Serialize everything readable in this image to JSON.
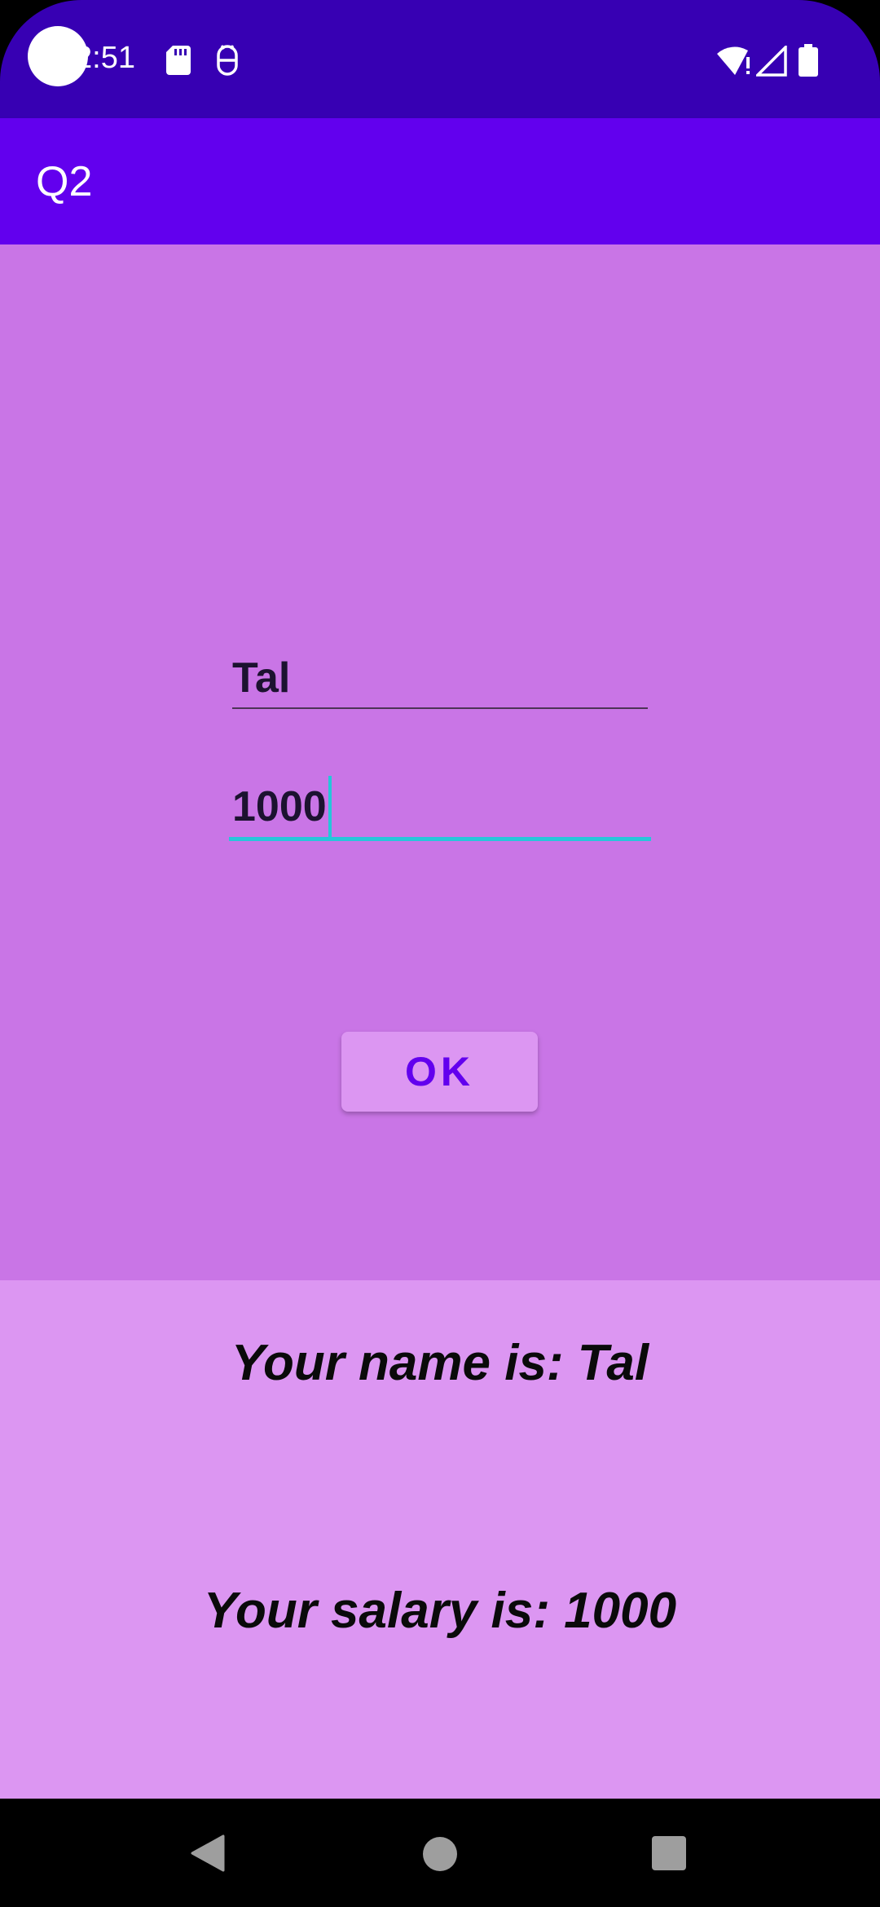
{
  "status_bar": {
    "time": "2:51",
    "icons": [
      "sd-card-icon",
      "debug-icon",
      "wifi-icon",
      "signal-icon",
      "battery-icon"
    ]
  },
  "app_bar": {
    "title": "Q2"
  },
  "form": {
    "name_value": "Tal",
    "salary_value": "1000",
    "ok_label": "OK"
  },
  "results": {
    "name_text": "Your name is: Tal",
    "salary_text": "Your salary is: 1000"
  },
  "colors": {
    "status_bar": "#3700b3",
    "app_bar": "#6200ee",
    "main_bg": "#c975e6",
    "results_bg": "#dc96f2",
    "accent": "#26c6da"
  },
  "nav_bar": {
    "buttons": [
      "back-icon",
      "home-icon",
      "recents-icon"
    ]
  }
}
